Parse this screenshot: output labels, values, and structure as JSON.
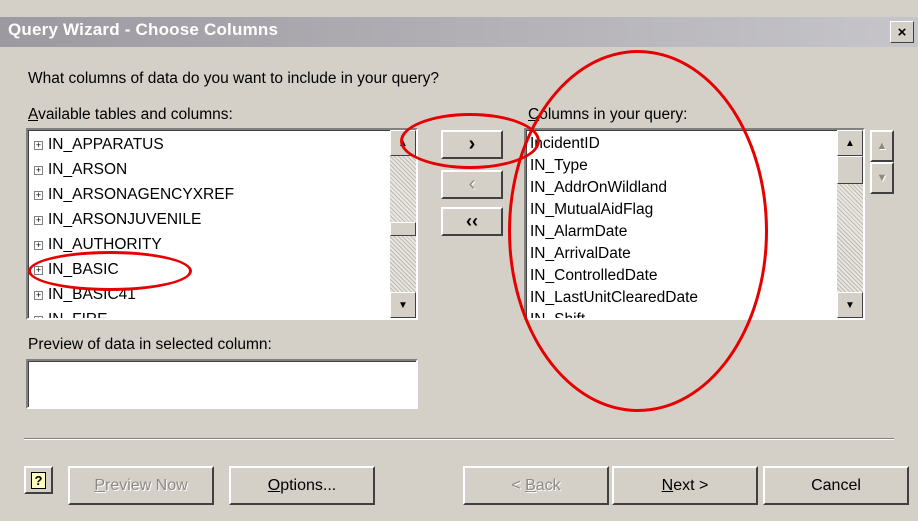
{
  "window": {
    "title": "Query Wizard - Choose Columns",
    "close_glyph": "×"
  },
  "prompt": "What columns of data do you want to include in your query?",
  "available": {
    "label_first": "A",
    "label_rest": "vailable tables and columns:",
    "items": [
      {
        "label": "IN_APPARATUS",
        "expander": "+"
      },
      {
        "label": "IN_ARSON",
        "expander": "+"
      },
      {
        "label": "IN_ARSONAGENCYXREF",
        "expander": "+"
      },
      {
        "label": "IN_ARSONJUVENILE",
        "expander": "+"
      },
      {
        "label": "IN_AUTHORITY",
        "expander": "+"
      },
      {
        "label": "IN_BASIC",
        "expander": "+"
      },
      {
        "label": "IN_BASIC41",
        "expander": "+"
      },
      {
        "label": "IN_FIRE",
        "expander": "+"
      }
    ]
  },
  "move_buttons": {
    "add": "›",
    "remove": "‹",
    "remove_all": "‹‹"
  },
  "selected": {
    "label_first": "C",
    "label_rest": "olumns in your query:",
    "items": [
      "IncidentID",
      "IN_Type",
      "IN_AddrOnWildland",
      "IN_MutualAidFlag",
      "IN_AlarmDate",
      "IN_ArrivalDate",
      "IN_ControlledDate",
      "IN_LastUnitClearedDate",
      "IN_Shift"
    ]
  },
  "preview": {
    "label": "Preview of data in selected column:",
    "value": ""
  },
  "footer": {
    "help_glyph": "?",
    "preview_now_first": "P",
    "preview_now_rest": "review Now",
    "options_first": "O",
    "options_rest": "ptions...",
    "back_prefix": "< ",
    "back_first": "B",
    "back_rest": "ack",
    "next_first": "N",
    "next_rest": "ext >",
    "cancel": "Cancel"
  },
  "colors": {
    "dialog_bg": "#d4d0c8",
    "title_bar": "#9c9aa0",
    "annotation": "#e60000",
    "disabled_text": "#8c8a85"
  }
}
